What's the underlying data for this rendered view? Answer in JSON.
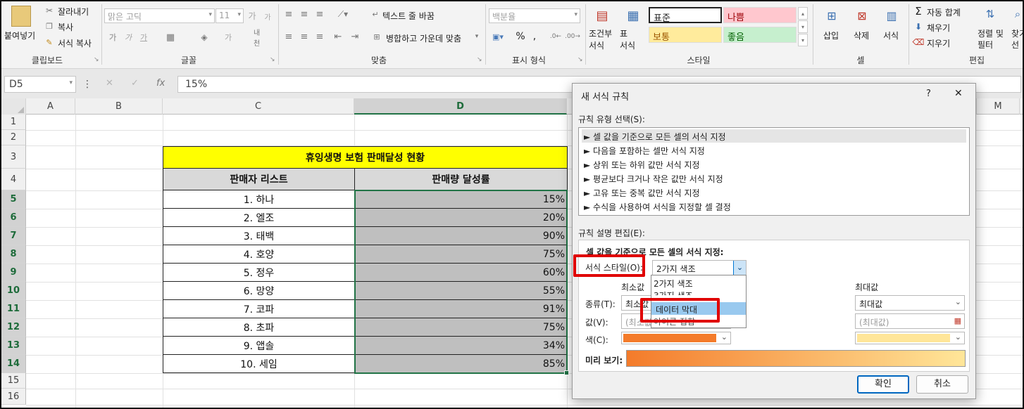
{
  "ribbon": {
    "clipboard": {
      "paste": "붙여넣기",
      "cut": "잘라내기",
      "copy": "복사",
      "format_painter": "서식 복사",
      "label": "클립보드"
    },
    "font": {
      "name": "맑은 고딕",
      "size": "11",
      "label": "글꼴"
    },
    "alignment": {
      "wrap": "텍스트 줄 바꿈",
      "merge": "병합하고 가운데 맞춤",
      "label": "맞춤"
    },
    "number": {
      "format": "백분율",
      "label": "표시 형식"
    },
    "styles": {
      "conditional": "조건부\n서식",
      "table": "표\n서식",
      "normal": "표준",
      "bad": "나쁨",
      "neutral": "보통",
      "good": "좋음",
      "label": "스타일"
    },
    "cells": {
      "insert": "삽입",
      "delete": "삭제",
      "format": "서식",
      "label": "셀"
    },
    "editing": {
      "autosum": "자동 합계",
      "fill": "채우기",
      "clear": "지우기",
      "sort": "정렬 및\n필터",
      "find": "찾기\n선",
      "label": "편집"
    }
  },
  "formula_bar": {
    "name_box": "D5",
    "formula": "15%"
  },
  "sheet": {
    "columns": [
      "A",
      "B",
      "C",
      "D",
      "M"
    ],
    "selected_column": "D",
    "rows": [
      "1",
      "2",
      "3",
      "4",
      "5",
      "6",
      "7",
      "8",
      "9",
      "10",
      "11",
      "12",
      "13",
      "14",
      "15",
      "16"
    ],
    "title": "휴잉생명 보험 판매달성 현황",
    "col_c_header": "판매자 리스트",
    "col_d_header": "판매량 달성률",
    "records": [
      {
        "name": "1. 하나",
        "rate": "15%"
      },
      {
        "name": "2. 엘조",
        "rate": "20%"
      },
      {
        "name": "3. 태백",
        "rate": "90%"
      },
      {
        "name": "4. 호양",
        "rate": "75%"
      },
      {
        "name": "5. 정우",
        "rate": "60%"
      },
      {
        "name": "6. 망양",
        "rate": "55%"
      },
      {
        "name": "7. 코파",
        "rate": "91%"
      },
      {
        "name": "8. 초파",
        "rate": "75%"
      },
      {
        "name": "9. 앱솔",
        "rate": "34%"
      },
      {
        "name": "10. 세임",
        "rate": "85%"
      }
    ]
  },
  "dialog": {
    "title": "새 서식 규칙",
    "help": "?",
    "close": "✕",
    "rule_type_label": "규칙 유형 선택(S):",
    "rule_types": [
      "► 셀 값을 기준으로 모든 셀의 서식 지정",
      "► 다음을 포함하는 셀만 서식 지정",
      "► 상위 또는 하위 값만 서식 지정",
      "► 평균보다 크거나 작은 값만 서식 지정",
      "► 고유 또는 중복 값만 서식 지정",
      "► 수식을 사용하여 서식을 지정할 셀 결정"
    ],
    "edit_label": "규칙 설명 편집(E):",
    "desc_heading": "셀 값을 기준으로 모든 셀의 서식 지정:",
    "format_style_label": "서식 스타일(O):",
    "format_style_value": "2가지 색조",
    "dropdown_options": [
      "2가지 색조",
      "3가지 색조",
      "데이터 막대",
      "아이콘 집합"
    ],
    "min_label": "최소값",
    "max_label": "최대값",
    "type_label": "종류(T):",
    "value_label": "값(V):",
    "color_label": "색(C):",
    "min_type": "최소값",
    "max_type": "최대값",
    "min_value": "(최소값)",
    "max_value": "(최대값)",
    "min_color": "#f47b2a",
    "max_color": "#ffe699",
    "preview_label": "미리 보기:",
    "ok": "확인",
    "cancel": "취소"
  }
}
